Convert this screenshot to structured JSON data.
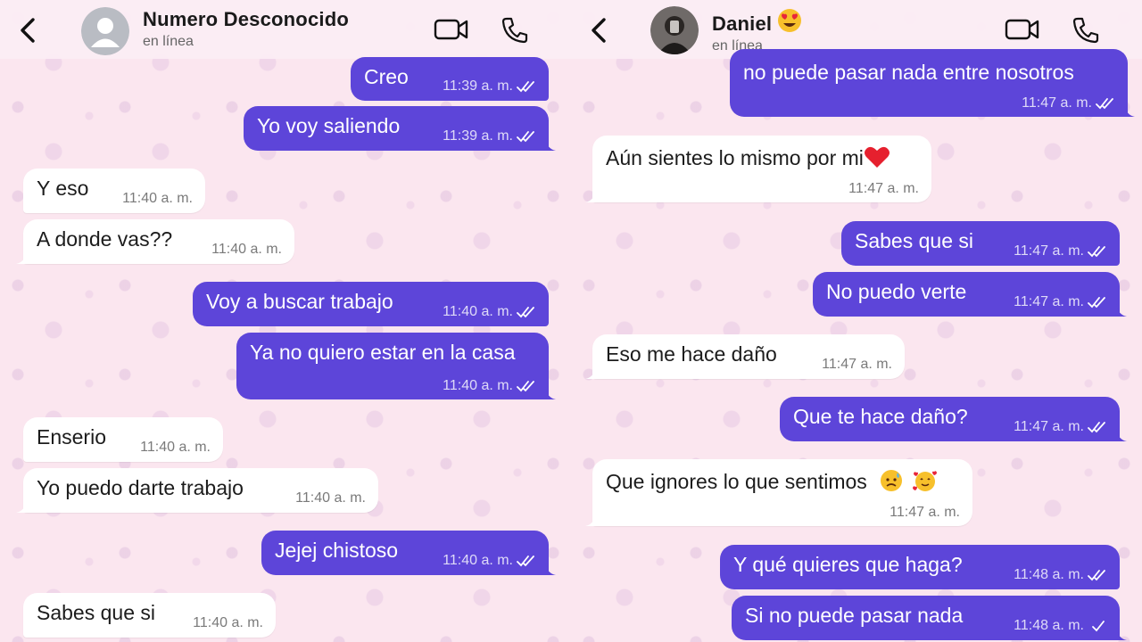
{
  "left": {
    "contact_name": "Numero Desconocido",
    "status": "en línea",
    "messages": [
      {
        "text": "Creo",
        "time": "11:39 a. m.",
        "dir": "out"
      },
      {
        "text": "Yo voy saliendo",
        "time": "11:39 a. m.",
        "dir": "out"
      },
      {
        "text": "Y eso",
        "time": "11:40 a. m.",
        "dir": "in"
      },
      {
        "text": "A donde vas??",
        "time": "11:40 a. m.",
        "dir": "in"
      },
      {
        "text": "Voy a buscar trabajo",
        "time": "11:40 a. m.",
        "dir": "out"
      },
      {
        "text": "Ya no quiero estar en la casa",
        "time": "11:40 a. m.",
        "dir": "out"
      },
      {
        "text": "Enserio",
        "time": "11:40 a. m.",
        "dir": "in"
      },
      {
        "text": "Yo puedo darte trabajo",
        "time": "11:40 a. m.",
        "dir": "in"
      },
      {
        "text": "Jejej chistoso",
        "time": "11:40 a. m.",
        "dir": "out"
      },
      {
        "text": "Sabes que si",
        "time": "11:40 a. m.",
        "dir": "in"
      }
    ]
  },
  "right": {
    "contact_name": "Daniel",
    "status": "en línea",
    "messages": [
      {
        "text": "no puede pasar nada entre nosotros",
        "time": "11:47 a. m.",
        "dir": "out"
      },
      {
        "text": "Aún sientes lo mismo por mi",
        "time": "11:47 a. m.",
        "dir": "in"
      },
      {
        "text": "Sabes que si",
        "time": "11:47 a. m.",
        "dir": "out"
      },
      {
        "text": "No puedo verte",
        "time": "11:47 a. m.",
        "dir": "out"
      },
      {
        "text": "Eso me hace daño",
        "time": "11:47 a. m.",
        "dir": "in"
      },
      {
        "text": "Que te hace daño?",
        "time": "11:47 a. m.",
        "dir": "out"
      },
      {
        "text": "Que ignores lo que sentimos",
        "time": "11:47 a. m.",
        "dir": "in"
      },
      {
        "text": "Y qué quieres que haga?",
        "time": "11:48 a. m.",
        "dir": "out"
      },
      {
        "text": "Si no puede pasar nada",
        "time": "11:48 a. m.",
        "dir": "out"
      }
    ]
  },
  "icons": {
    "back": "back-arrow-icon",
    "video": "video-camera-icon",
    "call": "phone-icon",
    "read": "double-check-icon",
    "sent": "single-check-icon"
  },
  "colors": {
    "outgoing_bubble": "#5d45d9",
    "incoming_bubble": "#ffffff",
    "background": "#fbe6ef"
  }
}
